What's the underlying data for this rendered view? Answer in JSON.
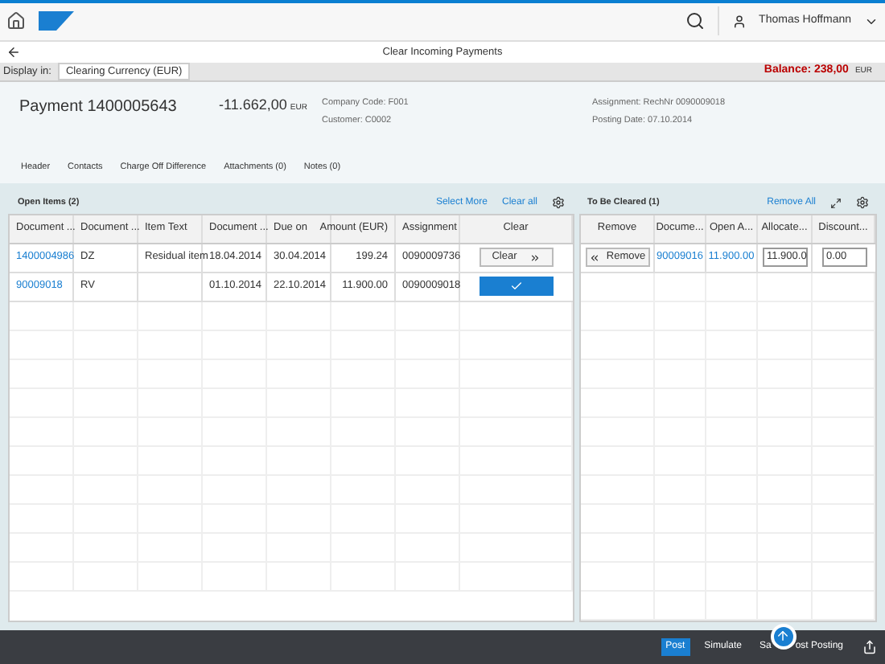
{
  "shell": {
    "user": "Thomas Hoffmann"
  },
  "page": {
    "title": "Clear Incoming Payments"
  },
  "display": {
    "label": "Display in:",
    "value": "Clearing Currency (EUR)",
    "balance_label": "Balance: 238,00",
    "balance_currency": "EUR"
  },
  "header": {
    "title": "Payment 1400005643",
    "amount": "-11.662,00",
    "currency": "EUR",
    "attributes": [
      "Company Code: F001",
      "Customer: C0002"
    ],
    "attributes_right": [
      "Assignment: RechNr 0090009018",
      "Posting Date: 07.10.2014"
    ]
  },
  "tabs": [
    {
      "label": "Header"
    },
    {
      "label": "Contacts"
    },
    {
      "label": "Charge Off Difference"
    },
    {
      "label": "Attachments (0)"
    },
    {
      "label": "Notes (0)"
    }
  ],
  "open_items": {
    "title": "Open Items (2)",
    "actions": [
      "Select More",
      "Clear all"
    ],
    "columns": [
      "Document ...",
      "Document ...",
      "Item Text",
      "Document ...",
      "Due on",
      "Amount (EUR)",
      "Assignment",
      "Clear"
    ],
    "rows": [
      {
        "cells": [
          "1400004986",
          "DZ",
          "Residual item",
          "18.04.2014",
          "30.04.2014",
          "199.24",
          "0090009736"
        ],
        "clear_label": "Clear",
        "selected": false
      },
      {
        "cells": [
          "90009018",
          "RV",
          "",
          "01.10.2014",
          "22.10.2014",
          "11.900.00",
          "0090009018"
        ],
        "clear_label": "",
        "selected": true
      }
    ]
  },
  "to_be_cleared": {
    "title": "To Be Cleared (1)",
    "action": "Remove All",
    "columns": [
      "Remove",
      "Docume...",
      "Open A...",
      "Allocate...",
      "Discount..."
    ],
    "rows": [
      {
        "remove_label": "Remove",
        "document": "90009016",
        "open_amount": "11.900.00",
        "allocated": "11.900.0",
        "discount": "0.00"
      }
    ]
  },
  "footer": {
    "buttons": [
      {
        "label": "Post",
        "kind": "primary"
      },
      {
        "label": "Simulate",
        "kind": "plain"
      }
    ],
    "save_visible_start": "Sa",
    "save_visible_end": "ost Posting"
  }
}
